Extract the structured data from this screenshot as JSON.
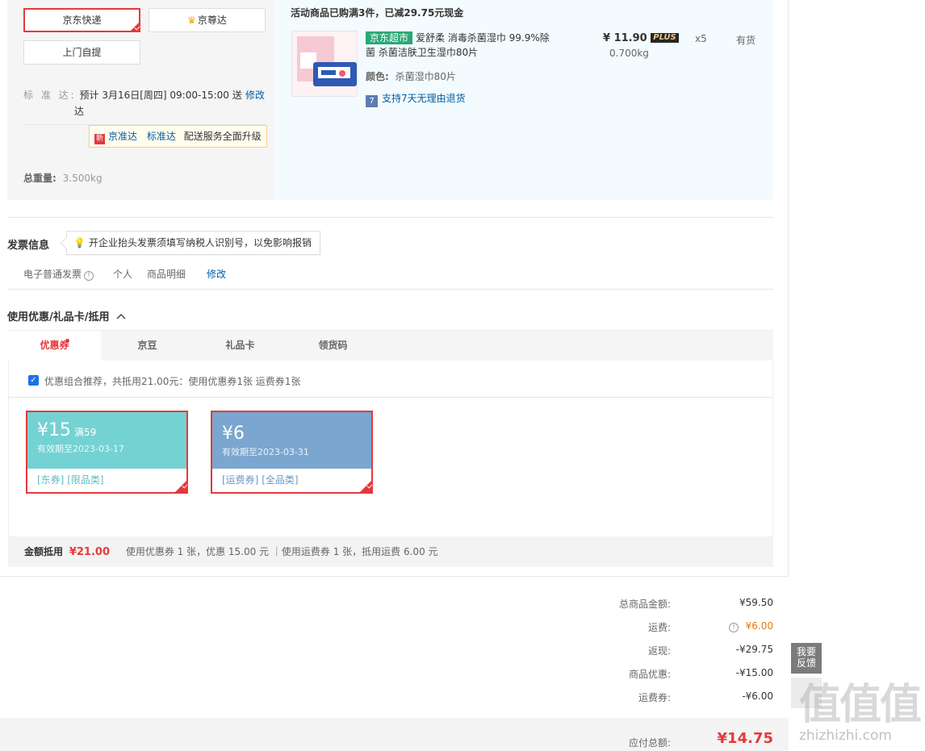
{
  "shipping": {
    "express_label": "京东快递",
    "premium_label": "京尊达",
    "pickup_label": "上门自提",
    "standard_label": "标 准 达:",
    "standard_time_line1": "预计 3月16日[周四] 09:00-15:00 送",
    "standard_time_line2": "达",
    "modify_label": "修改",
    "upgrade_tip": {
      "badge": "新",
      "link1": "京准达",
      "link2": "标准达",
      "text": "配送服务全面升级"
    },
    "total_weight_label": "总重量:",
    "total_weight_value": "3.500kg"
  },
  "product": {
    "promo_text": "活动商品已购满3件，已减29.75元现金",
    "market_tag": "京东超市",
    "name_line1": "爱舒柔 消毒杀菌湿巾 99.9%除",
    "name_line2": "菌 杀菌洁肤卫生湿巾80片",
    "price": "¥ 11.90",
    "plus_badge": "PLUS",
    "quantity": "x5",
    "stock": "有货",
    "weight": "0.700kg",
    "color_label": "颜色:",
    "color_value": "杀菌湿巾80片",
    "return_icon": "7",
    "return_text": "支持7天无理由退货"
  },
  "invoice": {
    "title": "发票信息",
    "tip": "开企业抬头发票须填写纳税人识别号，以免影响报销",
    "type": "电子普通发票",
    "info_icon": "!",
    "holder": "个人",
    "content": "商品明细",
    "modify_label": "修改"
  },
  "discount": {
    "title": "使用优惠/礼品卡/抵用",
    "toggle_icon": "chevron-up-icon",
    "tabs": [
      {
        "label": "优惠券"
      },
      {
        "label": "京豆"
      },
      {
        "label": "礼品卡"
      },
      {
        "label": "领货码"
      }
    ],
    "recommend_text": "优惠组合推荐，共抵用21.00元：使用优惠券1张 运费券1张",
    "coupons": [
      {
        "symbol": "¥",
        "amount": "15",
        "condition": "满59",
        "expiry": "有效期至2023-03-17",
        "tag1": "[东券]",
        "tag2": "[限品类]",
        "color": "#74d2d3",
        "tag_color": "#5fbcc4"
      },
      {
        "symbol": "¥",
        "amount": "6",
        "condition": "",
        "expiry": "有效期至2023-03-31",
        "tag1": "[运费券]",
        "tag2": "[全品类]",
        "color": "#7ba6d0",
        "tag_color": "#6a97c7"
      }
    ],
    "summary_label": "金额抵用",
    "summary_amount": "¥21.00",
    "summary_detail": "使用优惠券 1 张，优惠 15.00 元 ｜使用运费券 1 张，抵用运费 6.00 元"
  },
  "totals": {
    "rows": [
      {
        "label": "总商品金额:",
        "value": "¥59.50"
      },
      {
        "label": "运费:",
        "value": "¥6.00"
      },
      {
        "label": "返现:",
        "value": "-¥29.75"
      },
      {
        "label": "商品优惠:",
        "value": "-¥15.00"
      },
      {
        "label": "运费券:",
        "value": "-¥6.00"
      }
    ],
    "payable_label": "应付总额:",
    "payable_value": "¥14.75",
    "accent_red": "#e4393c",
    "shipping_fee_color": "#e4790f"
  },
  "feedback": {
    "line1": "我要",
    "line2": "反馈"
  },
  "watermark": {
    "big": "值值值",
    "small": "zhizhizhi.com"
  }
}
